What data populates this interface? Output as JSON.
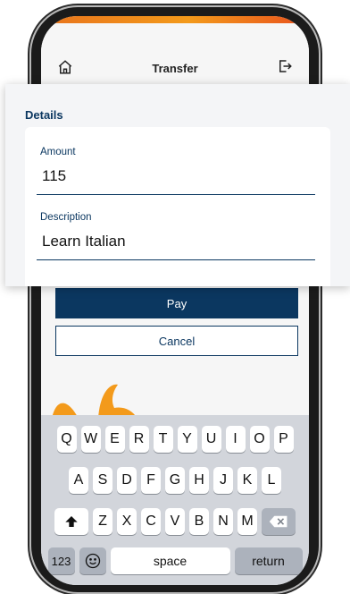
{
  "header": {
    "title": "Transfer",
    "home_icon": "home-icon",
    "logout_icon": "logout-icon"
  },
  "details": {
    "section_title": "Details",
    "amount_label": "Amount",
    "amount_value": "115",
    "description_label": "Description",
    "description_value": "Learn Italian"
  },
  "actions": {
    "pay_label": "Pay",
    "cancel_label": "Cancel"
  },
  "keyboard": {
    "row1": [
      "Q",
      "W",
      "E",
      "R",
      "T",
      "Y",
      "U",
      "I",
      "O",
      "P"
    ],
    "row2": [
      "A",
      "S",
      "D",
      "F",
      "G",
      "H",
      "J",
      "K",
      "L"
    ],
    "row3": [
      "Z",
      "X",
      "C",
      "V",
      "B",
      "N",
      "M"
    ],
    "numbers_label": "123",
    "space_label": "space",
    "return_label": "return",
    "shift_icon": "shift-icon",
    "delete_icon": "backspace-icon",
    "emoji_icon": "emoji-icon"
  },
  "colors": {
    "primary": "#0b3760",
    "accent_orange": "#f39a1b",
    "keyboard_bg": "#d2d5db"
  }
}
